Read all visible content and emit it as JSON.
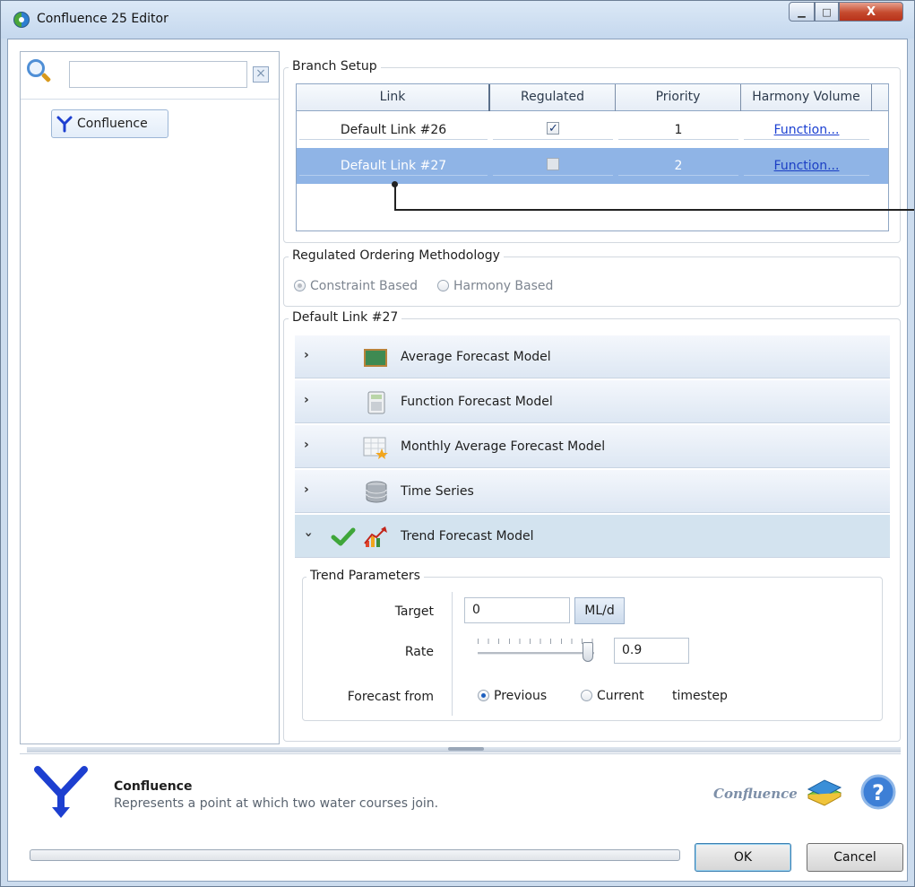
{
  "window": {
    "title": "Confluence 25 Editor",
    "controls": {
      "minimize": "▁",
      "maximize": "□",
      "close": "X"
    }
  },
  "sidebar": {
    "search": {
      "value": "",
      "placeholder": ""
    },
    "clear_icon": "×",
    "tree_items": [
      {
        "label": "Confluence",
        "icon": "confluence-y-icon"
      }
    ]
  },
  "branch_setup": {
    "group_label": "Branch Setup",
    "columns": [
      "Link",
      "Regulated",
      "Priority",
      "Harmony Volume"
    ],
    "rows": [
      {
        "link": "Default Link #26",
        "regulated": true,
        "priority": "1",
        "harmony": "Function..."
      },
      {
        "link": "Default Link #27",
        "regulated": false,
        "priority": "2",
        "harmony": "Function...",
        "selected": true
      }
    ]
  },
  "ordering": {
    "group_label": "Regulated Ordering Methodology",
    "options": [
      {
        "label": "Constraint Based",
        "selected": true,
        "enabled": false
      },
      {
        "label": "Harmony Based",
        "selected": false,
        "enabled": false
      }
    ]
  },
  "link_detail": {
    "group_label": "Default Link #27",
    "models": [
      {
        "label": "Average Forecast Model",
        "icon": "chalkboard-icon",
        "expanded": false
      },
      {
        "label": "Function Forecast Model",
        "icon": "calculator-icon",
        "expanded": false
      },
      {
        "label": "Monthly Average Forecast Model",
        "icon": "calendar-star-icon",
        "expanded": false
      },
      {
        "label": "Time Series",
        "icon": "database-icon",
        "expanded": false
      },
      {
        "label": "Trend Forecast Model",
        "icon": "trend-chart-icon",
        "expanded": true,
        "active": true
      }
    ],
    "trend": {
      "group_label": "Trend Parameters",
      "target_label": "Target",
      "target_value": "0",
      "target_unit": "ML/d",
      "rate_label": "Rate",
      "rate_value": "0.9",
      "rate_slider_fraction": 0.9,
      "forecast_from_label": "Forecast from",
      "forecast_options": [
        {
          "label": "Previous",
          "selected": true
        },
        {
          "label": "Current",
          "selected": false
        }
      ],
      "forecast_suffix": "timestep"
    }
  },
  "info": {
    "title": "Confluence",
    "description": "Represents a point at which two water courses join.",
    "brand_text": "Confluence"
  },
  "buttons": {
    "ok": "OK",
    "cancel": "Cancel"
  },
  "colors": {
    "selection": "#8fb4e6",
    "link": "#1a3fd1",
    "accent_blue": "#1d3fd0"
  }
}
